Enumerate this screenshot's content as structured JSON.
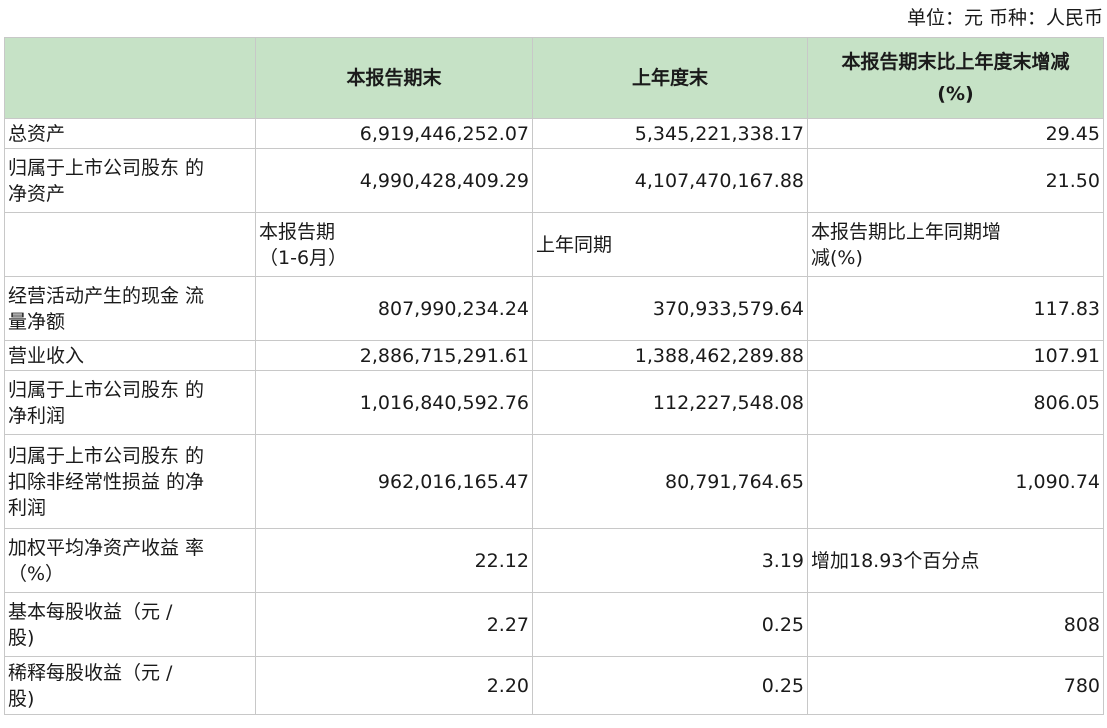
{
  "unit_note": "单位：元 币种：人民币",
  "header": {
    "col0": "",
    "col1": "本报告期末",
    "col2": "上年度末",
    "col3_line1": "本报告期末比上年度末增减",
    "col3_line2": "(%)"
  },
  "top_rows": [
    {
      "label_lines": [
        "总资产"
      ],
      "c1": "6,919,446,252.07",
      "c2": "5,345,221,338.17",
      "c3": "29.45"
    },
    {
      "label_lines": [
        "归属于上市公司股东 的",
        "净资产"
      ],
      "c1": "4,990,428,409.29",
      "c2": "4,107,470,167.88",
      "c3": "21.50"
    }
  ],
  "subheader": {
    "col0": "",
    "col1_line1": "本报告期",
    "col1_line2": "（1-6月）",
    "col2": "上年同期",
    "col3_line1": "本报告期比上年同期增",
    "col3_line2": "减(%)"
  },
  "bottom_rows": [
    {
      "label_lines": [
        "经营活动产生的现金 流",
        "量净额"
      ],
      "c1": "807,990,234.24",
      "c2": "370,933,579.64",
      "c3": "117.83"
    },
    {
      "label_lines": [
        "营业收入"
      ],
      "c1": "2,886,715,291.61",
      "c2": "1,388,462,289.88",
      "c3": "107.91"
    },
    {
      "label_lines": [
        "归属于上市公司股东 的",
        "净利润"
      ],
      "c1": "1,016,840,592.76",
      "c2": "112,227,548.08",
      "c3": "806.05"
    },
    {
      "label_lines": [
        "归属于上市公司股东 的",
        "扣除非经常性损益 的净",
        "利润"
      ],
      "c1": "962,016,165.47",
      "c2": "80,791,764.65",
      "c3": "1,090.74"
    },
    {
      "label_lines": [
        "加权平均净资产收益 率",
        "（%）"
      ],
      "c1": "22.12",
      "c2": "3.19",
      "c3": "增加18.93个百分点"
    },
    {
      "label_lines": [
        "基本每股收益（元 /",
        "股)"
      ],
      "c1": "2.27",
      "c2": "0.25",
      "c3": "808"
    },
    {
      "label_lines": [
        "稀释每股收益（元 /",
        "股)"
      ],
      "c1": "2.20",
      "c2": "0.25",
      "c3": "780"
    }
  ]
}
